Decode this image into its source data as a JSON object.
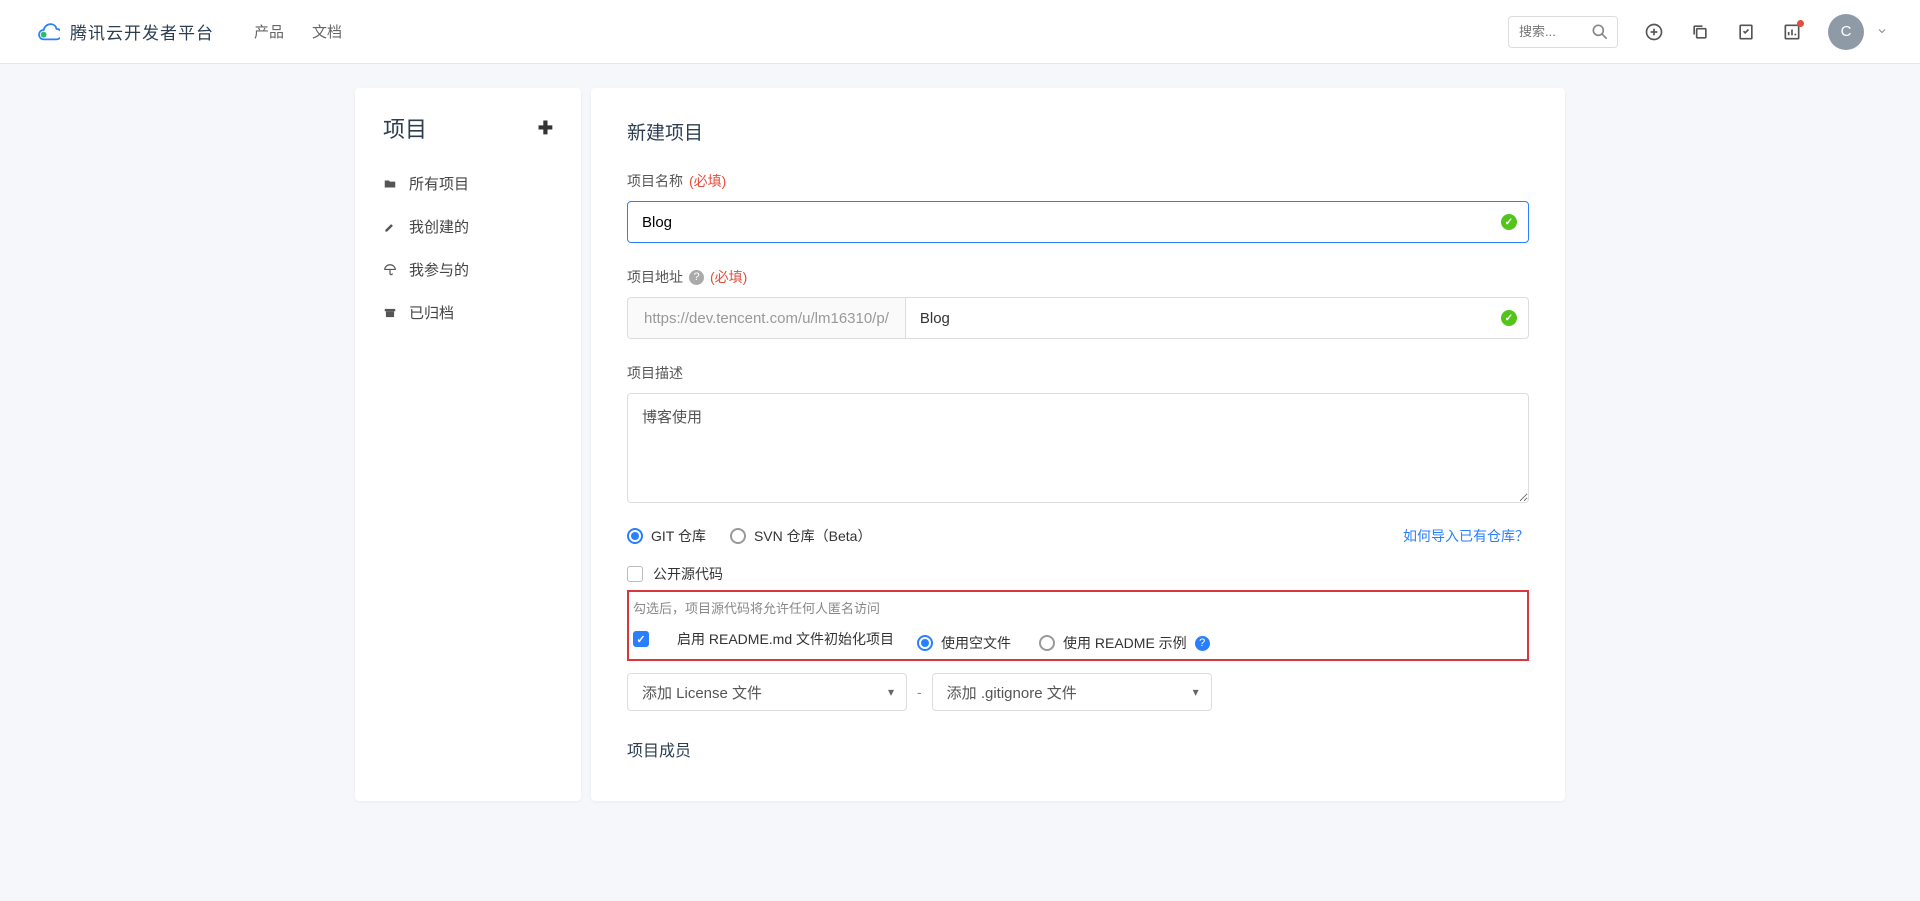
{
  "header": {
    "brand": "腾讯云开发者平台",
    "nav": {
      "products": "产品",
      "docs": "文档"
    },
    "search_placeholder": "搜索...",
    "avatar_letter": "C"
  },
  "sidebar": {
    "title": "项目",
    "items": [
      {
        "label": "所有项目",
        "icon": "folder"
      },
      {
        "label": "我创建的",
        "icon": "pencil"
      },
      {
        "label": "我参与的",
        "icon": "umbrella"
      },
      {
        "label": "已归档",
        "icon": "archive"
      }
    ]
  },
  "form": {
    "page_title": "新建项目",
    "name_label": "项目名称",
    "required": "(必填)",
    "name_value": "Blog",
    "url_label": "项目地址",
    "url_prefix": "https://dev.tencent.com/u/lm16310/p/",
    "url_value": "Blog",
    "desc_label": "项目描述",
    "desc_value": "博客使用",
    "repo_git": "GIT 仓库",
    "repo_svn": "SVN 仓库（Beta）",
    "import_link": "如何导入已有仓库？",
    "open_source": "公开源代码",
    "open_source_hint": "勾选后，项目源代码将允许任何人匿名访问",
    "readme_init": "启用 README.md 文件初始化项目",
    "readme_empty": "使用空文件",
    "readme_sample": "使用 README 示例",
    "license_select": "添加 License 文件",
    "gitignore_select": "添加 .gitignore 文件",
    "members_title": "项目成员"
  }
}
